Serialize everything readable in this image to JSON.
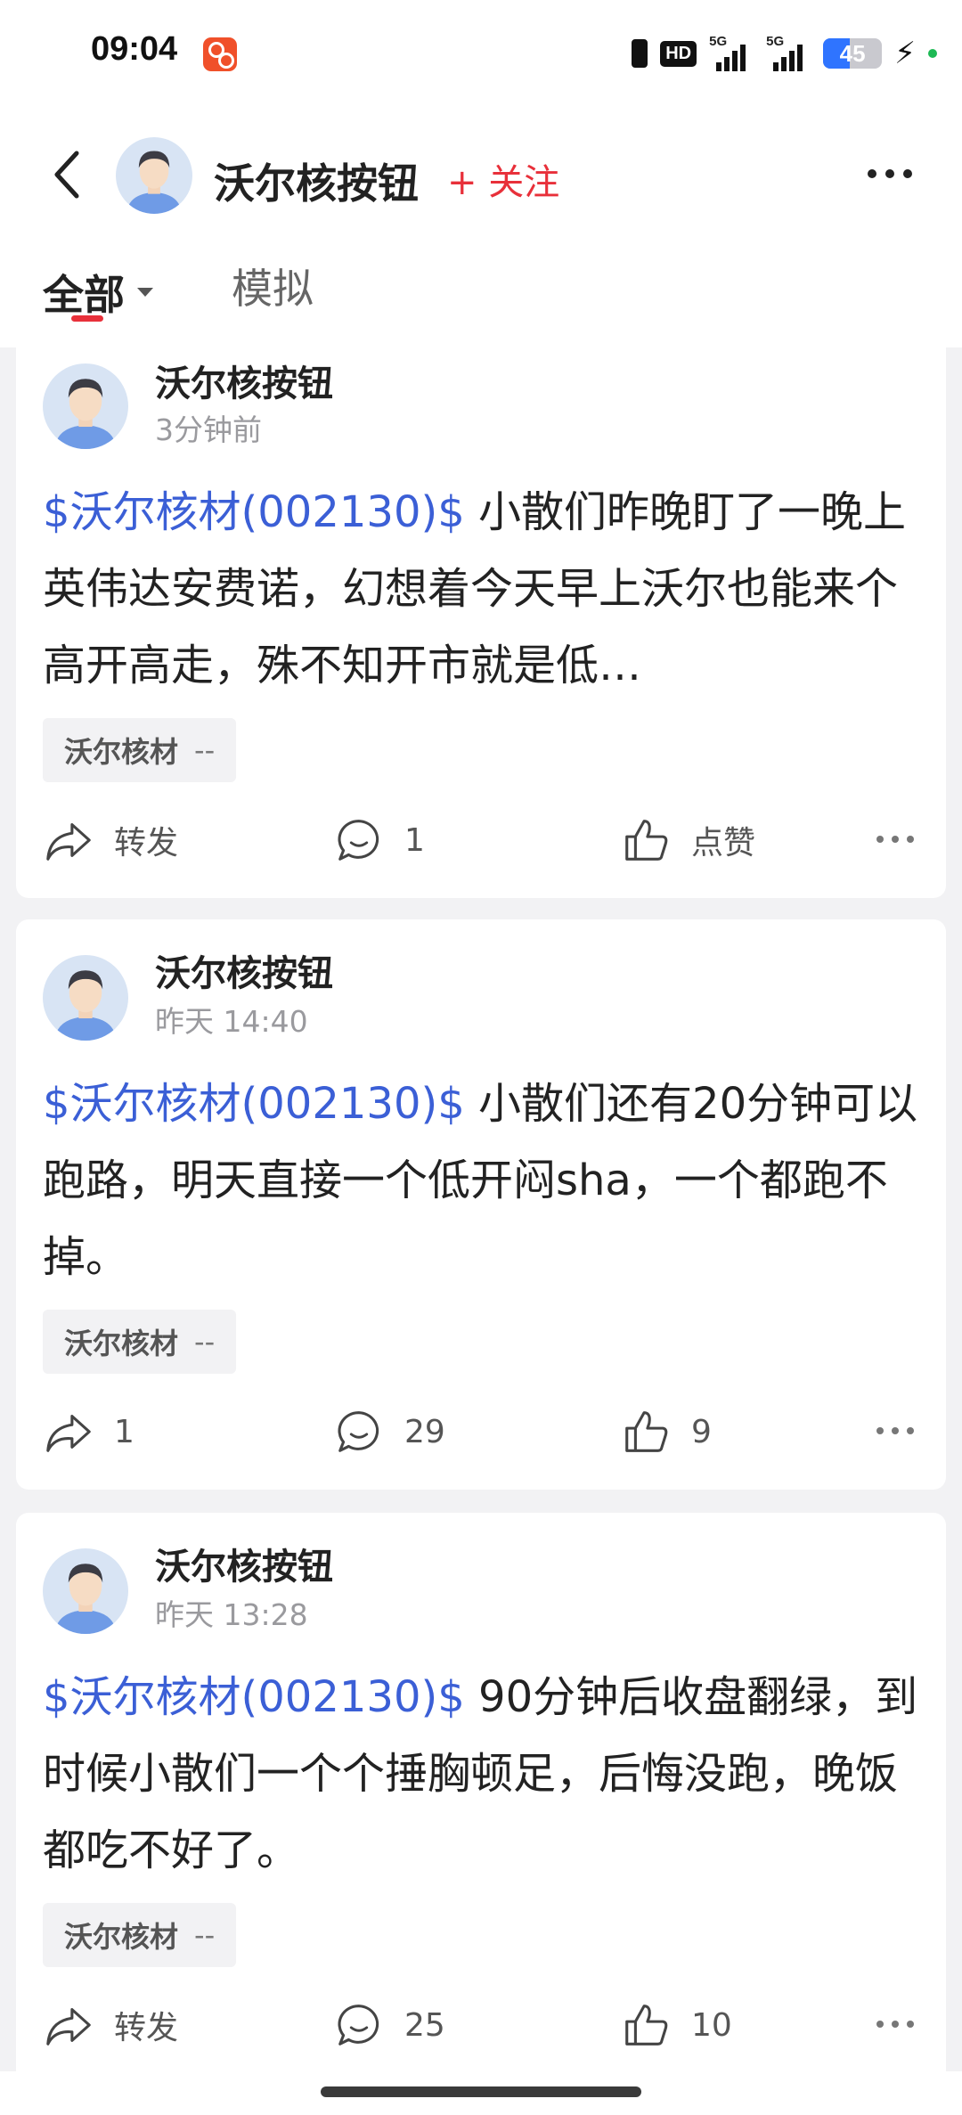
{
  "status_bar": {
    "time": "09:04",
    "app_icon": "kuaishou-like-icon",
    "hd": "HD",
    "signal1": "5G",
    "signal2": "5G",
    "battery": "45",
    "battery_level": 0.45,
    "accent": "#2f74ff"
  },
  "header": {
    "back_icon": "back-chevron-icon",
    "name": "沃尔核按钮",
    "follow": "+ 关注",
    "more_icon": "more-dots-icon"
  },
  "tabs": {
    "all": "全部",
    "sim": "模拟",
    "active_color": "#e8303a"
  },
  "posts": [
    {
      "author": "沃尔核按钮",
      "time": "3分钟前",
      "stock": "$沃尔核材(002130)$",
      "text": " 小散们昨晚盯了一晚上英伟达安费诺，幻想着今天早上沃尔也能来个高开高走，殊不知开市就是低…",
      "tag_name": "沃尔核材",
      "tag_change": "--",
      "repost": "转发",
      "comments": "1",
      "likes": "点赞"
    },
    {
      "author": "沃尔核按钮",
      "time": "昨天 14:40",
      "stock": "$沃尔核材(002130)$",
      "text": " 小散们还有20分钟可以跑路，明天直接一个低开闷sha，一个都跑不掉。",
      "tag_name": "沃尔核材",
      "tag_change": "--",
      "repost": "1",
      "comments": "29",
      "likes": "9"
    },
    {
      "author": "沃尔核按钮",
      "time": "昨天 13:28",
      "stock": "$沃尔核材(002130)$",
      "text": " 90分钟后收盘翻绿，到时候小散们一个个捶胸顿足，后悔没跑，晚饭都吃不好了。",
      "tag_name": "沃尔核材",
      "tag_change": "--",
      "repost": "转发",
      "comments": "25",
      "likes": "10"
    }
  ],
  "colors": {
    "stock_link": "#3b5fd6",
    "follow": "#e8303a"
  }
}
